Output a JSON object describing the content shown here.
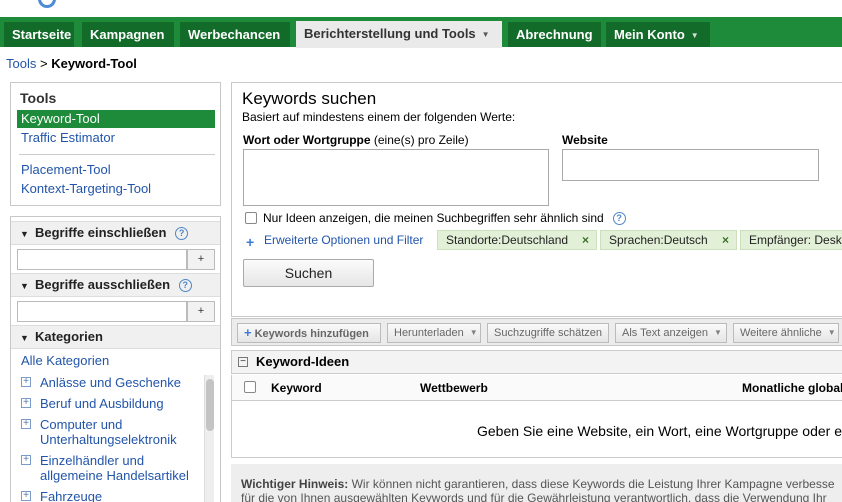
{
  "nav": {
    "tabs": [
      {
        "label": "Startseite"
      },
      {
        "label": "Kampagnen"
      },
      {
        "label": "Werbechancen"
      },
      {
        "label": "Berichterstellung und Tools"
      },
      {
        "label": "Abrechnung"
      },
      {
        "label": "Mein Konto"
      }
    ],
    "active_index": 3
  },
  "breadcrumb": {
    "parent": "Tools",
    "separator": ">",
    "current": "Keyword-Tool"
  },
  "sidebar": {
    "tools_title": "Tools",
    "tools": [
      {
        "label": "Keyword-Tool",
        "selected": true
      },
      {
        "label": "Traffic Estimator"
      },
      {
        "label": "Placement-Tool"
      },
      {
        "label": "Kontext-Targeting-Tool"
      }
    ],
    "include_label": "Begriffe einschließen",
    "exclude_label": "Begriffe ausschließen",
    "add_symbol": "+",
    "categories_label": "Kategorien",
    "all_categories": "Alle Kategorien",
    "categories": [
      {
        "label": "Anlässe und Geschenke"
      },
      {
        "label": "Beruf und Ausbildung"
      },
      {
        "label": "Computer und Unterhaltungselektronik"
      },
      {
        "label": "Einzelhändler und allgemeine Handelsartikel"
      },
      {
        "label": "Fahrzeuge"
      }
    ]
  },
  "search": {
    "title": "Keywords suchen",
    "subtitle": "Basiert auf mindestens einem der folgenden Werte:",
    "words_label": "Wort oder Wortgruppe",
    "words_hint": "(eine(s) pro Zeile)",
    "words_value": "",
    "website_label": "Website",
    "website_value": "",
    "similar_only_label": "Nur Ideen anzeigen, die meinen Suchbegriffen sehr ähnlich sind",
    "similar_only_checked": false,
    "advanced_label": "Erweiterte Optionen und Filter",
    "chips": [
      {
        "label": "Standorte:Deutschland"
      },
      {
        "label": "Sprachen:Deutsch"
      },
      {
        "label": "Empfänger: Desk"
      }
    ],
    "chip_remove_symbol": "×",
    "search_button": "Suchen"
  },
  "toolbar": {
    "add_keywords": "Keywords hinzufügen",
    "download": "Herunterladen",
    "estimate": "Suchzugriffe schätzen",
    "view_as_text": "Als Text anzeigen",
    "more_similar": "Weitere ähnliche"
  },
  "ideas": {
    "title": "Keyword-Ideen",
    "columns": [
      "Keyword",
      "Wettbewerb",
      "Monatliche globale"
    ],
    "empty_message": "Geben Sie eine Website, ein Wort, eine Wortgruppe oder e"
  },
  "notice": {
    "label": "Wichtiger Hinweis:",
    "line1": "Wir können nicht garantieren, dass diese Keywords die Leistung Ihrer Kampagne verbesse",
    "line2": "für die von Ihnen ausgewählten Keywords und für die Gewährleistung verantwortlich, dass die Verwendung Ihr"
  },
  "colors": {
    "nav_green": "#1d8b3a",
    "nav_tab_dark": "#136b2a",
    "link_blue": "#2255aa",
    "chip_green": "#e3f0d8"
  },
  "icons": {
    "help": "help-circle-icon",
    "expand": "plus-box-icon",
    "collapse": "minus-box-icon",
    "dropdown": "chevron-down-icon"
  }
}
